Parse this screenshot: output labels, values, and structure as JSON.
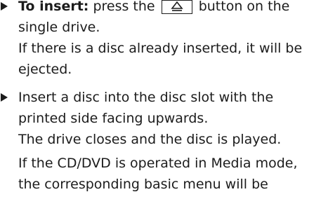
{
  "instructions": {
    "item1": {
      "heading": "To insert:",
      "text_before_icon": "press the",
      "icon": "eject-icon",
      "text_after_icon": "button on the",
      "line2": "single drive.",
      "note_line1": "If there is a disc already inserted, it will be",
      "note_line2": "ejected."
    },
    "item2": {
      "line1": "Insert a disc into the disc slot with the",
      "line2": "printed side facing upwards.",
      "line3": "The drive closes and the disc is played.",
      "note_line1": "If the CD/DVD is operated in Media mode,",
      "note_line2": "the corresponding basic menu will be"
    }
  }
}
